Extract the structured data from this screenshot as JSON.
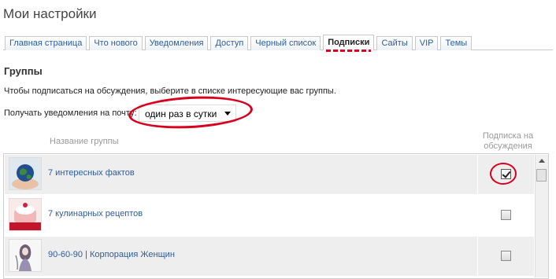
{
  "page": {
    "title": "Мои настройки"
  },
  "tabs": [
    {
      "label": "Главная страница"
    },
    {
      "label": "Что нового"
    },
    {
      "label": "Уведомления"
    },
    {
      "label": "Доступ"
    },
    {
      "label": "Черный список"
    },
    {
      "label": "Подписки",
      "active": true
    },
    {
      "label": "Сайты"
    },
    {
      "label": "VIP"
    },
    {
      "label": "Темы"
    }
  ],
  "section": {
    "title": "Группы",
    "info": "Чтобы подписаться на обсуждения, выберите в списке интересующие вас группы.",
    "notify_label": "Получать уведомления на почту:",
    "notify_value": "один раз в сутки"
  },
  "table": {
    "col_name": "Название группы",
    "col_sub_line1": "Подписка на",
    "col_sub_line2": "обсуждения",
    "rows": [
      {
        "name": "7 интересных фактов",
        "subscribed": true,
        "thumb": "globe-in-hands-thumb"
      },
      {
        "name": "7 кулинарных рецептов",
        "subscribed": false,
        "thumb": "cupcakes-thumb"
      },
      {
        "name": "90-60-90 | Корпорация Женщин",
        "subscribed": false,
        "thumb": "woman-sketch-thumb"
      }
    ]
  },
  "colors": {
    "link": "#2b5d9c",
    "highlight": "#d8001c",
    "row_shade": "#eeeeee"
  }
}
